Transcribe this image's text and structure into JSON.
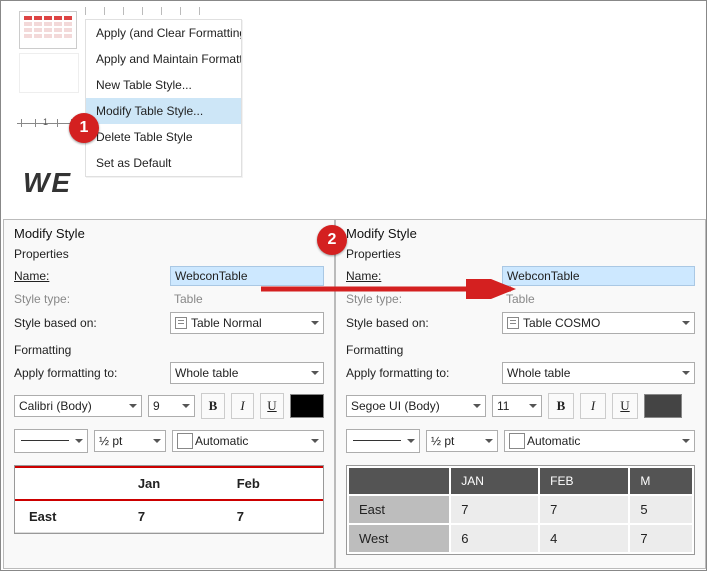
{
  "context_menu": {
    "items": [
      {
        "label": "Apply (and Clear Formatting)",
        "u": "C"
      },
      {
        "label": "Apply and Maintain Formatting",
        "u": "M"
      },
      {
        "label": "New Table Style...",
        "u": "N"
      },
      {
        "label": "Modify Table Style...",
        "u": ""
      },
      {
        "label": "Delete Table Style",
        "u": "D"
      },
      {
        "label": "Set as Default",
        "u": "D"
      }
    ],
    "highlighted_index": 3
  },
  "we_text": "WE",
  "markers": {
    "m1": "1",
    "m2": "2"
  },
  "dialog_left": {
    "title": "Modify Style",
    "sect_props": "Properties",
    "name_label": "Name:",
    "name_value": "WebconTable",
    "type_label": "Style type:",
    "type_value": "Table",
    "based_label": "Style based on:",
    "based_value": "Table Normal",
    "sect_fmt": "Formatting",
    "apply_label": "Apply formatting to:",
    "apply_value": "Whole table",
    "font": "Calibri (Body)",
    "size": "9",
    "weight": "½ pt",
    "color": "Automatic",
    "table": {
      "c1": "",
      "c2": "Jan",
      "c3": "Feb",
      "r1": "East",
      "v1": "7",
      "v2": "7"
    }
  },
  "dialog_right": {
    "title": "Modify Style",
    "sect_props": "Properties",
    "name_label": "Name:",
    "name_value": "WebconTable",
    "type_label": "Style type:",
    "type_value": "Table",
    "based_label": "Style based on:",
    "based_value": "Table COSMO",
    "sect_fmt": "Formatting",
    "apply_label": "Apply formatting to:",
    "apply_value": "Whole table",
    "font": "Segoe UI (Body)",
    "size": "11",
    "weight": "½ pt",
    "color": "Automatic",
    "table": {
      "c1": "",
      "c2": "JAN",
      "c3": "FEB",
      "c4": "M",
      "r1": "East",
      "v11": "7",
      "v12": "7",
      "v13": "5",
      "r2": "West",
      "v21": "6",
      "v22": "4",
      "v23": "7"
    },
    "swatch": "#444444"
  },
  "ruler_label": "1"
}
